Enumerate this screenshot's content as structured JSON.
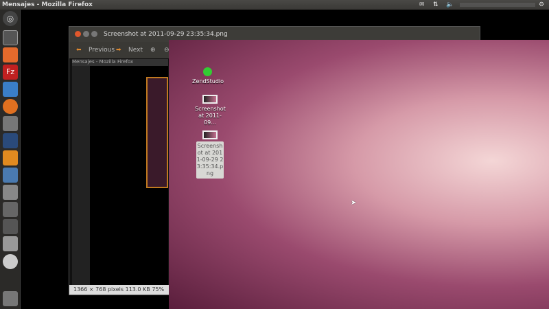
{
  "topbar": {
    "title": "Mensajes - Mozilla Firefox",
    "tray_icons": [
      "mail-icon",
      "network-icon",
      "volume-icon",
      "gear-icon"
    ]
  },
  "launcher": {
    "items": [
      "ubuntu-logo-icon",
      "terminal-icon",
      "home-folder-icon",
      "filezilla-icon",
      "browser-icon",
      "firefox-icon",
      "gimp-icon",
      "inkscape-icon",
      "blender-icon",
      "network-manager-icon",
      "text-editor-icon",
      "camera-icon",
      "system-settings-icon",
      "disk-icon",
      "cd-icon",
      "trash-icon"
    ]
  },
  "viewer": {
    "title": "Screenshot at 2011-09-29 23:35:34.png",
    "previous": "Previous",
    "next": "Next",
    "inner_title": "Mensajes - Mozilla Firefox",
    "status": "1366 × 768 pixels  113.0 KB  75%"
  },
  "desktop": {
    "icons": [
      {
        "label": "ZendStudio"
      },
      {
        "label": "Screenshot at 2011-09..."
      },
      {
        "label": "Screenshot at 2011-09-29 23:35:34.png"
      }
    ]
  }
}
